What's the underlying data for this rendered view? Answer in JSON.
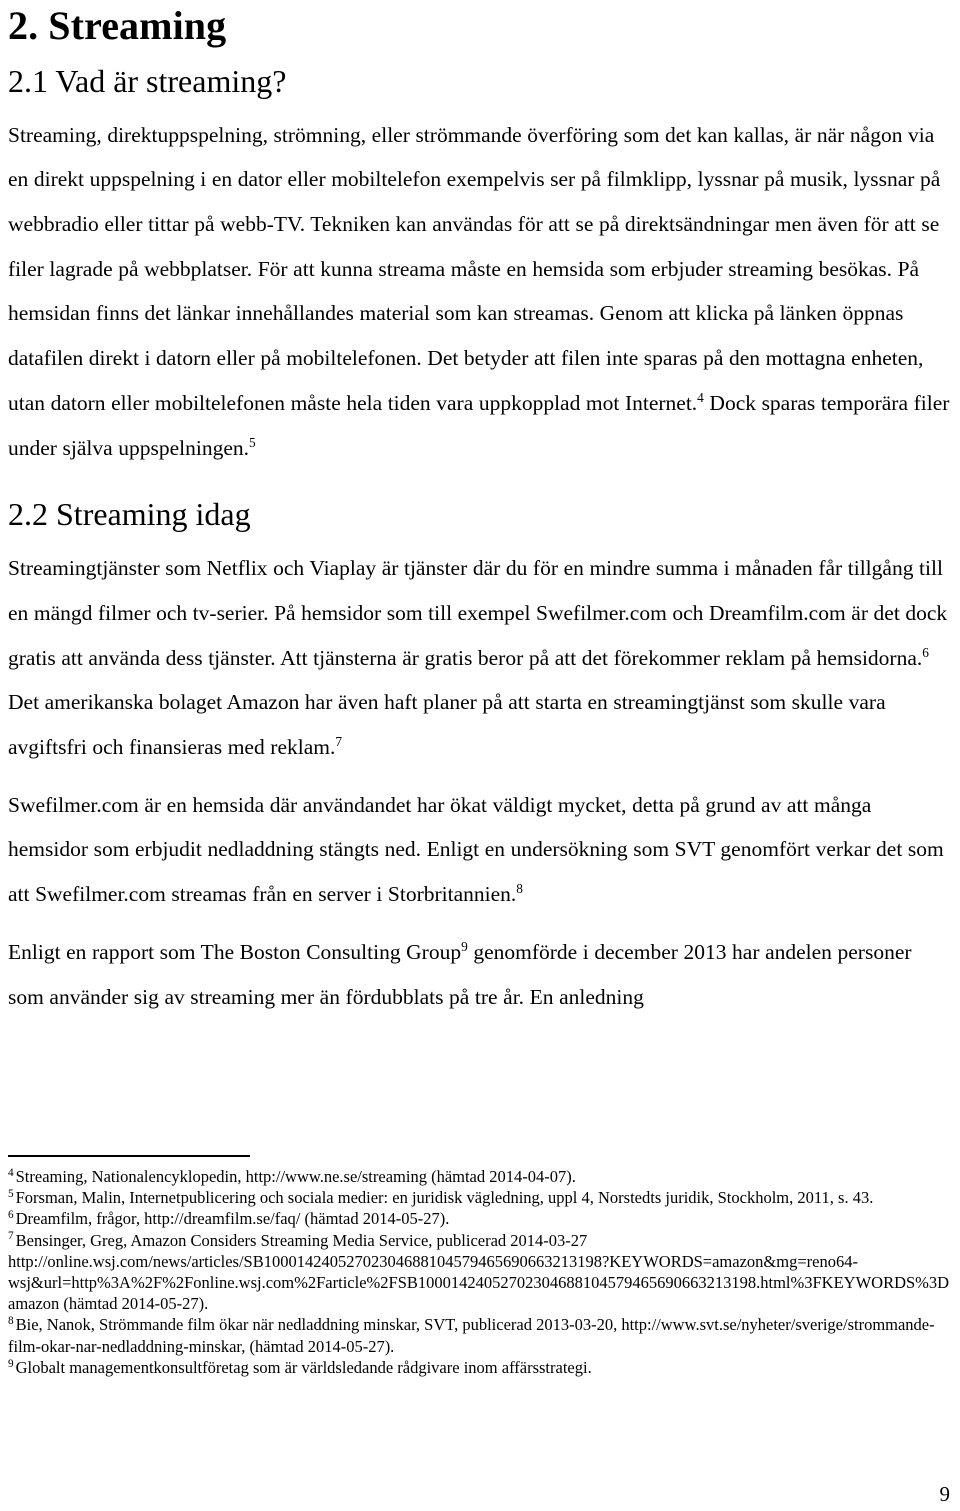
{
  "document": {
    "page_number": "9",
    "headings": {
      "chapter": "2. Streaming",
      "section_21": "2.1 Vad är streaming?",
      "section_22": "2.2 Streaming idag"
    },
    "paragraphs": {
      "p1_a": "Streaming, direktuppspelning, strömning, eller strömmande överföring som det kan kallas, är när någon via en direkt uppspelning i en dator eller mobiltelefon exempelvis ser på filmklipp, lyssnar på musik, lyssnar på webbradio eller tittar på webb-TV. Tekniken kan användas för att se på direktsändningar men även för att se filer lagrade på webbplatser. För att kunna streama måste en hemsida som erbjuder streaming besökas. På hemsidan finns det länkar innehållandes material som kan streamas. Genom att klicka på länken öppnas datafilen direkt i datorn eller på mobiltelefonen. Det betyder att filen inte sparas på den mottagna enheten, utan datorn eller mobiltelefonen måste hela tiden vara uppkopplad mot Internet.",
      "p1_fn": "4",
      "p1_b": " Dock sparas temporära filer under själva uppspelningen.",
      "p1_fn2": "5",
      "p2_a": "Streamingtjänster som Netflix och Viaplay är tjänster där du för en mindre summa i månaden får tillgång till en mängd filmer och tv-serier. På hemsidor som till exempel Swefilmer.com och Dreamfilm.com är det dock gratis att använda dess tjänster. Att tjänsterna är gratis beror på att det förekommer reklam på hemsidorna.",
      "p2_fn": "6",
      "p2_b": " Det amerikanska bolaget Amazon har även haft planer på att starta en streamingtjänst som skulle vara avgiftsfri och finansieras med reklam.",
      "p2_fn2": "7",
      "p3_a": "Swefilmer.com är en hemsida där användandet har ökat väldigt mycket, detta på grund av att många hemsidor som erbjudit nedladdning stängts ned. Enligt en undersökning som SVT genomfört verkar det som att Swefilmer.com streamas från en server i Storbritannien.",
      "p3_fn": "8",
      "p4_a": "Enligt en rapport som The Boston Consulting Group",
      "p4_fn": "9",
      "p4_b": " genomförde i december 2013 har andelen personer som använder sig av streaming mer än fördubblats på tre år. En anledning"
    },
    "footnotes": [
      {
        "marker": "4",
        "text": "Streaming, Nationalencyklopedin, http://www.ne.se/streaming (hämtad 2014-04-07)."
      },
      {
        "marker": "5",
        "text": "Forsman, Malin, Internetpublicering och sociala medier: en juridisk vägledning, uppl 4, Norstedts juridik, Stockholm, 2011, s. 43."
      },
      {
        "marker": "6",
        "text": "Dreamfilm, frågor, http://dreamfilm.se/faq/ (hämtad 2014-05-27)."
      },
      {
        "marker": "7",
        "text": "Bensinger, Greg, Amazon Considers Streaming Media Service, publicerad 2014-03-27 http://online.wsj.com/news/articles/SB10001424052702304688104579465690663213198?KEYWORDS=amazon&mg=reno64-wsj&url=http%3A%2F%2Fonline.wsj.com%2Farticle%2FSB10001424052702304688104579465690663213198.html%3FKEYWORDS%3Damazon (hämtad 2014-05-27)."
      },
      {
        "marker": "8",
        "text": "Bie, Nanok, Strömmande film ökar när nedladdning minskar, SVT, publicerad 2013-03-20, http://www.svt.se/nyheter/sverige/strommande-film-okar-nar-nedladdning-minskar, (hämtad 2014-05-27)."
      },
      {
        "marker": "9",
        "text": "Globalt managementkonsultföretag som är världsledande rådgivare inom affärsstrategi."
      }
    ]
  }
}
